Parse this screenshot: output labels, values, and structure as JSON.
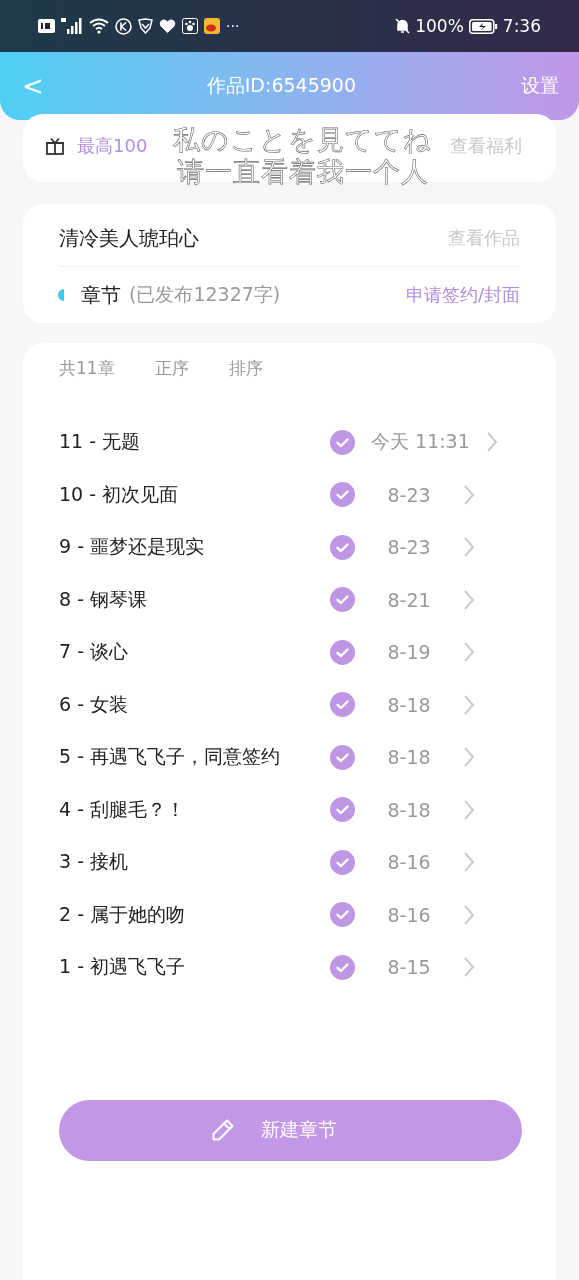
{
  "status_bar": {
    "more": "···",
    "battery": "100%",
    "time": "7:36"
  },
  "header": {
    "back": "<",
    "title": "作品ID:6545900",
    "action": "设置"
  },
  "banner": {
    "text": "最高100",
    "link": "查看福利"
  },
  "overlay": {
    "line_1": "私のことを見ててね",
    "line_2": "请一直看着我一个人"
  },
  "work": {
    "title": "清冷美人琥珀心",
    "link": "查看作品",
    "section": "章节",
    "published": "(已发布12327字)",
    "apply": "申请签约/封面"
  },
  "list_header": {
    "count": "共11章",
    "order": "正序",
    "sort": "排序"
  },
  "chapters": [
    {
      "title": "11 - 无题",
      "published": true,
      "date": "今天 11:31"
    },
    {
      "title": "10 - 初次见面",
      "published": true,
      "date": "8-23"
    },
    {
      "title": "9 - 噩梦还是现实",
      "published": true,
      "date": "8-23"
    },
    {
      "title": "8 - 钢琴课",
      "published": true,
      "date": "8-21"
    },
    {
      "title": "7 - 谈心",
      "published": true,
      "date": "8-19"
    },
    {
      "title": "6 - 女装",
      "published": true,
      "date": "8-18"
    },
    {
      "title": "5 - 再遇飞飞子，同意签约",
      "published": true,
      "date": "8-18"
    },
    {
      "title": "4 - 刮腿毛？！",
      "published": true,
      "date": "8-18"
    },
    {
      "title": "3 - 接机",
      "published": true,
      "date": "8-16"
    },
    {
      "title": "2 - 属于她的吻",
      "published": true,
      "date": "8-16"
    },
    {
      "title": "1 - 初遇飞飞子",
      "published": true,
      "date": "8-15"
    }
  ],
  "new_button": "新建章节"
}
